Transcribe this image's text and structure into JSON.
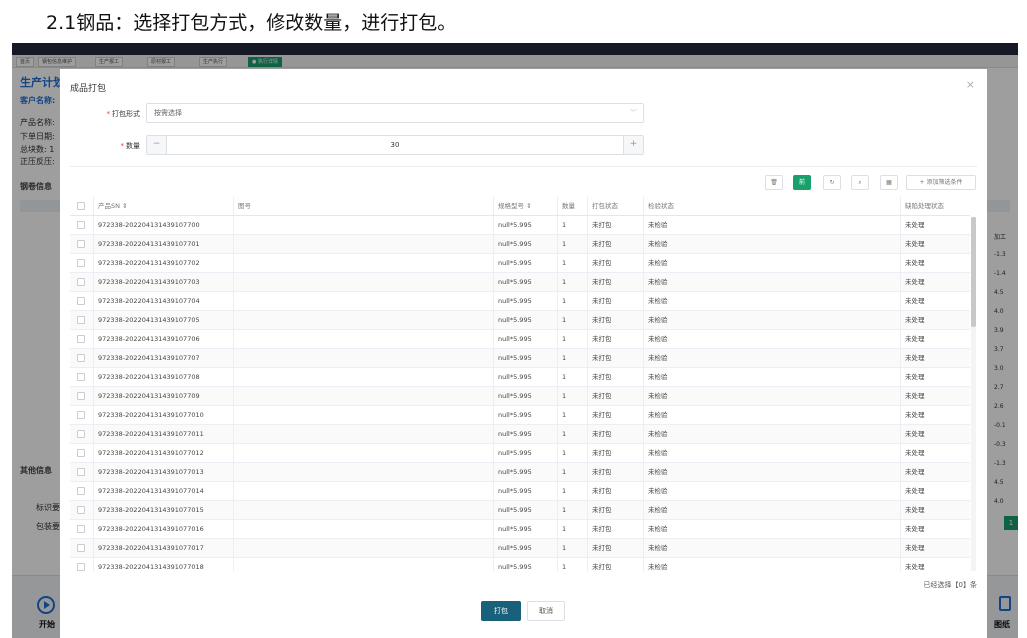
{
  "caption": "2.1钢品：选择打包方式，修改数量，进行打包。",
  "background": {
    "tabs": [
      "首页",
      "钢包信息维护",
      "生产报工",
      "原材报工",
      "生产执行",
      "● 执行详情"
    ],
    "plan_title": "生产计划",
    "customer_label": "客户名称:",
    "info_lines": [
      "产品名称:",
      "下单日期:",
      "总块数: 1",
      "正压反压:"
    ],
    "coil_info": "钢卷信息",
    "other_info": "其他信息",
    "label_a": "标识要",
    "label_b": "包装要",
    "right_header": "加工",
    "right_values": [
      "-1.3",
      "-1.4",
      "4.5",
      "4.0",
      "3.9",
      "3.7",
      "3.0",
      "2.7",
      "2.6",
      "-0.1",
      "-0.3",
      "-1.3",
      "4.5",
      "4.0"
    ],
    "next_page": "1",
    "start_label": "开始",
    "drawing_label": "图纸"
  },
  "modal": {
    "title": "成品打包",
    "close_icon": "×",
    "pack_type_label": "打包形式",
    "pack_type_placeholder": "按需选择",
    "quantity_label": "数量",
    "quantity_value": "30",
    "minus": "−",
    "plus": "+",
    "toolbar": {
      "delete_icon": "🗑",
      "green_btn": "前",
      "refresh_icon": "↻",
      "search_icon": "⌕",
      "columns_icon": "▦",
      "add_filter_label": "+ 添加筛选条件"
    },
    "columns": [
      "产品SN ⇕",
      "图号",
      "规格型号 ⇕",
      "数量",
      "打包状态",
      "检验状态",
      "缺陷处理状态"
    ],
    "rows": [
      [
        "972338-202204131439107700",
        "",
        "null*5.995",
        "1",
        "未打包",
        "未检验",
        "未处理"
      ],
      [
        "972338-202204131439107701",
        "",
        "null*5.995",
        "1",
        "未打包",
        "未检验",
        "未处理"
      ],
      [
        "972338-202204131439107702",
        "",
        "null*5.995",
        "1",
        "未打包",
        "未检验",
        "未处理"
      ],
      [
        "972338-202204131439107703",
        "",
        "null*5.995",
        "1",
        "未打包",
        "未检验",
        "未处理"
      ],
      [
        "972338-202204131439107704",
        "",
        "null*5.995",
        "1",
        "未打包",
        "未检验",
        "未处理"
      ],
      [
        "972338-202204131439107705",
        "",
        "null*5.995",
        "1",
        "未打包",
        "未检验",
        "未处理"
      ],
      [
        "972338-202204131439107706",
        "",
        "null*5.995",
        "1",
        "未打包",
        "未检验",
        "未处理"
      ],
      [
        "972338-202204131439107707",
        "",
        "null*5.995",
        "1",
        "未打包",
        "未检验",
        "未处理"
      ],
      [
        "972338-202204131439107708",
        "",
        "null*5.995",
        "1",
        "未打包",
        "未检验",
        "未处理"
      ],
      [
        "972338-202204131439107709",
        "",
        "null*5.995",
        "1",
        "未打包",
        "未检验",
        "未处理"
      ],
      [
        "972338-2022041314391077010",
        "",
        "null*5.995",
        "1",
        "未打包",
        "未检验",
        "未处理"
      ],
      [
        "972338-2022041314391077011",
        "",
        "null*5.995",
        "1",
        "未打包",
        "未检验",
        "未处理"
      ],
      [
        "972338-2022041314391077012",
        "",
        "null*5.995",
        "1",
        "未打包",
        "未检验",
        "未处理"
      ],
      [
        "972338-2022041314391077013",
        "",
        "null*5.995",
        "1",
        "未打包",
        "未检验",
        "未处理"
      ],
      [
        "972338-2022041314391077014",
        "",
        "null*5.995",
        "1",
        "未打包",
        "未检验",
        "未处理"
      ],
      [
        "972338-2022041314391077015",
        "",
        "null*5.995",
        "1",
        "未打包",
        "未检验",
        "未处理"
      ],
      [
        "972338-2022041314391077016",
        "",
        "null*5.995",
        "1",
        "未打包",
        "未检验",
        "未处理"
      ],
      [
        "972338-2022041314391077017",
        "",
        "null*5.995",
        "1",
        "未打包",
        "未检验",
        "未处理"
      ],
      [
        "972338-2022041314391077018",
        "",
        "null*5.995",
        "1",
        "未打包",
        "未检验",
        "未处理"
      ]
    ],
    "selected_info": "已经选择【0】条",
    "pack_button": "打包",
    "cancel_button": "取消"
  },
  "colors": {
    "accent_green": "#19a06b",
    "primary_button": "#19607a",
    "link_blue": "#1f6fd6"
  }
}
